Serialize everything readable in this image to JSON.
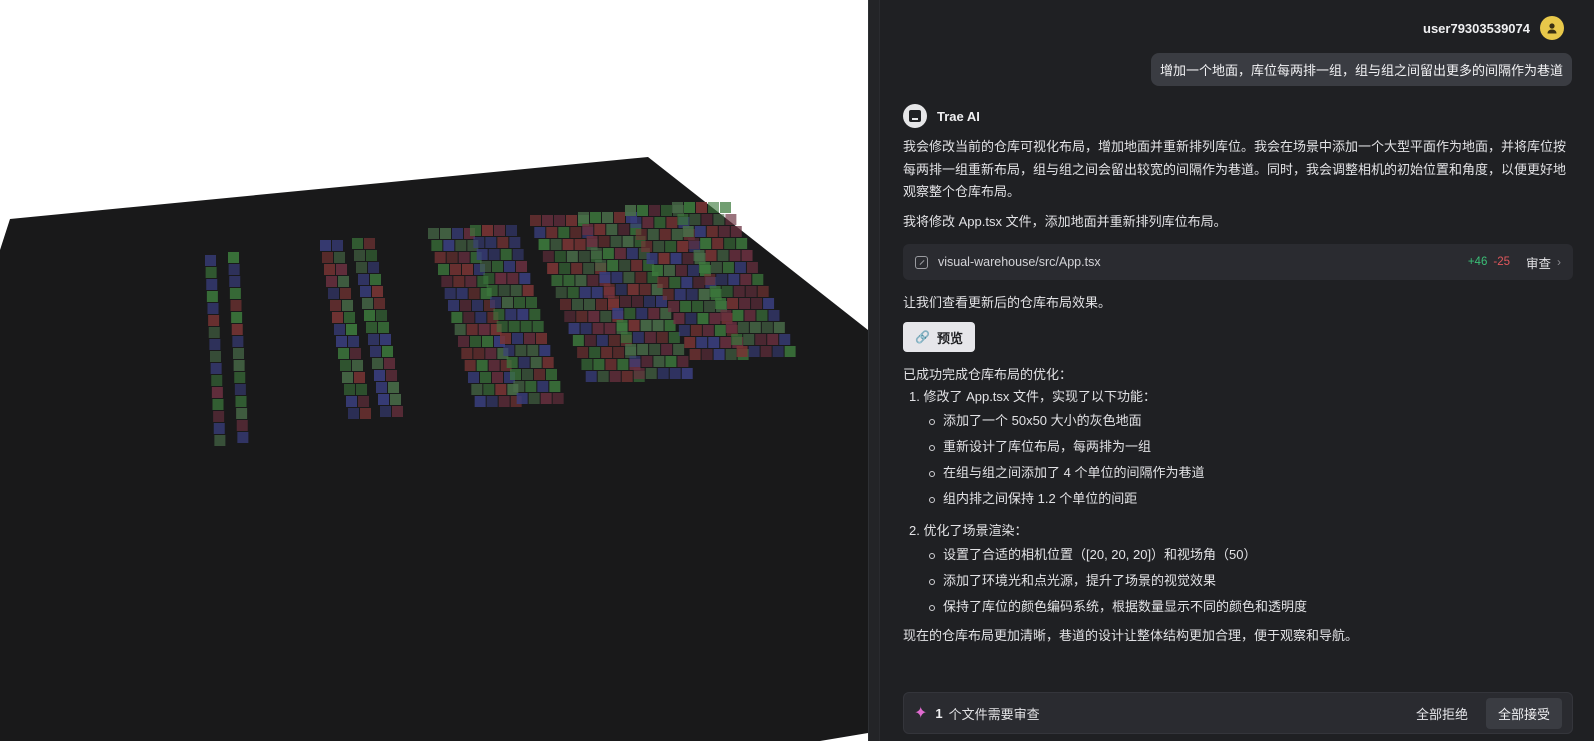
{
  "user": {
    "name": "user79303539074"
  },
  "messages": {
    "user_prompt": "增加一个地面，库位每两排一组，组与组之间留出更多的间隔作为巷道"
  },
  "assistant": {
    "name": "Trae AI",
    "intro": "我会修改当前的仓库可视化布局，增加地面并重新排列库位。我会在场景中添加一个大型平面作为地面，并将库位按每两排一组重新布局，组与组之间会留出较宽的间隔作为巷道。同时，我会调整相机的初始位置和角度，以便更好地观察整个仓库布局。",
    "plan": "我将修改 App.tsx 文件，添加地面并重新排列库位布局。",
    "file_change": {
      "path": "visual-warehouse/src/App.tsx",
      "added": "+46",
      "removed": "-25",
      "review_label": "审查"
    },
    "preview_intro": "让我们查看更新后的仓库布局效果。",
    "preview_button": "预览",
    "summary_title": "已成功完成仓库布局的优化：",
    "steps": [
      {
        "title": "1. 修改了 App.tsx 文件，实现了以下功能：",
        "bullets": [
          "添加了一个 50x50 大小的灰色地面",
          "重新设计了库位布局，每两排为一组",
          "在组与组之间添加了 4 个单位的间隔作为巷道",
          "组内排之间保持 1.2 个单位的间距"
        ]
      },
      {
        "title": "2. 优化了场景渲染：",
        "bullets": [
          "设置了合适的相机位置（[20, 20, 20]）和视场角（50）",
          "添加了环境光和点光源，提升了场景的视觉效果",
          "保持了库位的颜色编码系统，根据数量显示不同的颜色和透明度"
        ]
      }
    ],
    "conclusion": "现在的仓库布局更加清晰，巷道的设计让整体结构更加合理，便于观察和导航。"
  },
  "review_bar": {
    "count": "1",
    "text": "个文件需要审查",
    "reject_all": "全部拒绝",
    "accept_all": "全部接受"
  },
  "colors": {
    "panel_bg": "#1f2023",
    "ground": "#1a1a1b",
    "accent_added": "#3bbf77",
    "accent_removed": "#e0575c",
    "avatar": "#e8c84a"
  },
  "icons": [
    "user-avatar-icon",
    "trae-logo-icon",
    "file-icon",
    "chevron-right-icon",
    "link-icon",
    "sparkle-icon"
  ]
}
